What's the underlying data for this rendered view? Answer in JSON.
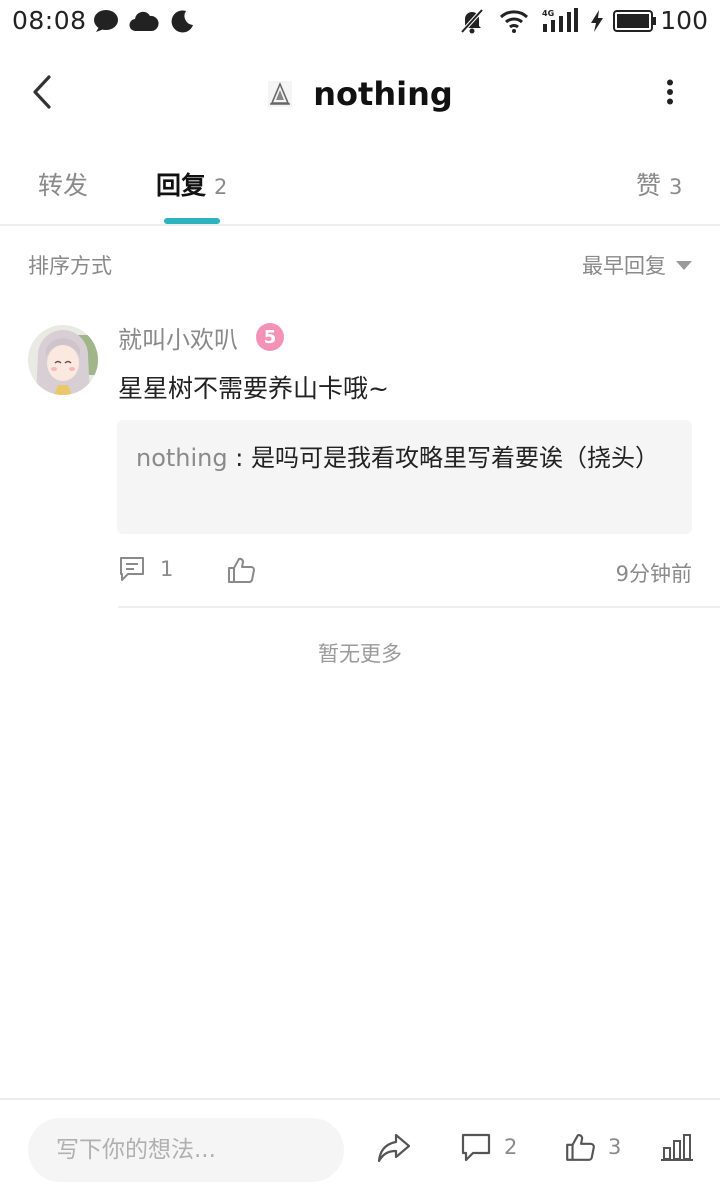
{
  "status_bar": {
    "time": "08:08",
    "battery_percent": "100",
    "network_label": "4G",
    "icons": [
      "message-bubble-icon",
      "cloud-icon",
      "moon-icon",
      "mute-bell-icon",
      "wifi-icon",
      "signal-icon",
      "charging-icon",
      "battery-icon"
    ]
  },
  "header": {
    "title": "nothing",
    "back_icon": "chevron-left-icon",
    "more_icon": "more-vertical-icon"
  },
  "tabs": [
    {
      "label": "转发",
      "count": "",
      "active": false
    },
    {
      "label": "回复",
      "count": "2",
      "active": true
    },
    {
      "label": "赞",
      "count": "3",
      "active": false
    }
  ],
  "sort": {
    "label": "排序方式",
    "value": "最早回复"
  },
  "comment": {
    "username": "就叫小欢叭",
    "level": "5",
    "text": "星星树不需要养山卡哦~",
    "quote": {
      "author": "nothing",
      "separator": " : ",
      "text": "是吗可是我看攻略里写着要诶（挠头）"
    },
    "reply_count": "1",
    "time": "9分钟前"
  },
  "footer_note": "暂无更多",
  "bottom_bar": {
    "input_placeholder": "写下你的想法...",
    "comment_count": "2",
    "like_count": "3"
  },
  "colors": {
    "accent": "#2bb3c0",
    "level_badge": "#f392b4",
    "muted_text": "#8a8a8a",
    "quote_bg": "#f5f5f5"
  }
}
